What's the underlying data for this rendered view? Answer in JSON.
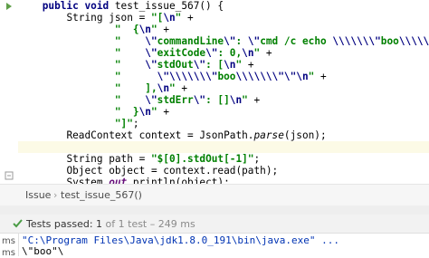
{
  "editor": {
    "lines": [
      {
        "indent": "    ",
        "tokens": [
          {
            "t": "public void ",
            "c": "kw"
          },
          {
            "t": "test_issue_567() {",
            "c": ""
          }
        ]
      },
      {
        "indent": "        ",
        "tokens": [
          {
            "t": "String json = ",
            "c": ""
          },
          {
            "t": "\"[",
            "c": "str"
          },
          {
            "t": "\\n",
            "c": "esc"
          },
          {
            "t": "\"",
            "c": "str"
          },
          {
            "t": " +",
            "c": ""
          }
        ]
      },
      {
        "indent": "                ",
        "tokens": [
          {
            "t": "\"  {",
            "c": "str"
          },
          {
            "t": "\\n",
            "c": "esc"
          },
          {
            "t": "\"",
            "c": "str"
          },
          {
            "t": " +",
            "c": ""
          }
        ]
      },
      {
        "indent": "                ",
        "tokens": [
          {
            "t": "\"    ",
            "c": "str"
          },
          {
            "t": "\\\"",
            "c": "esc"
          },
          {
            "t": "commandLine",
            "c": "str"
          },
          {
            "t": "\\\"",
            "c": "esc"
          },
          {
            "t": ": ",
            "c": "str"
          },
          {
            "t": "\\\"",
            "c": "esc"
          },
          {
            "t": "cmd /c echo ",
            "c": "str"
          },
          {
            "t": "\\\\\\\\\\\\\\\"",
            "c": "esc"
          },
          {
            "t": "boo",
            "c": "str"
          },
          {
            "t": "\\\\\\\\\\\\\\\"",
            "c": "esc"
          },
          {
            "t": "\\\"",
            "c": "esc"
          },
          {
            "t": ",",
            "c": "str"
          },
          {
            "t": "\\n",
            "c": "esc"
          },
          {
            "t": "\" +",
            "c": "str"
          }
        ]
      },
      {
        "indent": "                ",
        "tokens": [
          {
            "t": "\"    ",
            "c": "str"
          },
          {
            "t": "\\\"",
            "c": "esc"
          },
          {
            "t": "exitCode",
            "c": "str"
          },
          {
            "t": "\\\"",
            "c": "esc"
          },
          {
            "t": ": 0,",
            "c": "str"
          },
          {
            "t": "\\n",
            "c": "esc"
          },
          {
            "t": "\"",
            "c": "str"
          },
          {
            "t": " +",
            "c": ""
          }
        ]
      },
      {
        "indent": "                ",
        "tokens": [
          {
            "t": "\"    ",
            "c": "str"
          },
          {
            "t": "\\\"",
            "c": "esc"
          },
          {
            "t": "stdOut",
            "c": "str"
          },
          {
            "t": "\\\"",
            "c": "esc"
          },
          {
            "t": ": [",
            "c": "str"
          },
          {
            "t": "\\n",
            "c": "esc"
          },
          {
            "t": "\"",
            "c": "str"
          },
          {
            "t": " +",
            "c": ""
          }
        ]
      },
      {
        "indent": "                ",
        "tokens": [
          {
            "t": "\"      ",
            "c": "str"
          },
          {
            "t": "\\\"\\\\\\\\\\\\\\\"",
            "c": "esc"
          },
          {
            "t": "boo",
            "c": "str"
          },
          {
            "t": "\\\\\\\\\\\\\\\"\\\"",
            "c": "esc"
          },
          {
            "t": "\\n",
            "c": "esc"
          },
          {
            "t": "\"",
            "c": "str"
          },
          {
            "t": " +",
            "c": ""
          }
        ]
      },
      {
        "indent": "                ",
        "tokens": [
          {
            "t": "\"    ],",
            "c": "str"
          },
          {
            "t": "\\n",
            "c": "esc"
          },
          {
            "t": "\"",
            "c": "str"
          },
          {
            "t": " +",
            "c": ""
          }
        ]
      },
      {
        "indent": "                ",
        "tokens": [
          {
            "t": "\"    ",
            "c": "str"
          },
          {
            "t": "\\\"",
            "c": "esc"
          },
          {
            "t": "stdErr",
            "c": "str"
          },
          {
            "t": "\\\"",
            "c": "esc"
          },
          {
            "t": ": []",
            "c": "str"
          },
          {
            "t": "\\n",
            "c": "esc"
          },
          {
            "t": "\"",
            "c": "str"
          },
          {
            "t": " +",
            "c": ""
          }
        ]
      },
      {
        "indent": "                ",
        "tokens": [
          {
            "t": "\"  }",
            "c": "str"
          },
          {
            "t": "\\n",
            "c": "esc"
          },
          {
            "t": "\"",
            "c": "str"
          },
          {
            "t": " +",
            "c": ""
          }
        ]
      },
      {
        "indent": "                ",
        "tokens": [
          {
            "t": "\"]\"",
            "c": "str"
          },
          {
            "t": ";",
            "c": ""
          }
        ]
      },
      {
        "indent": "        ",
        "tokens": [
          {
            "t": "ReadContext context = JsonPath.",
            "c": ""
          },
          {
            "t": "parse",
            "c": "mth"
          },
          {
            "t": "(json);",
            "c": ""
          }
        ]
      },
      {
        "indent": "",
        "tokens": [],
        "highlight": true
      },
      {
        "indent": "        ",
        "tokens": [
          {
            "t": "String path = ",
            "c": ""
          },
          {
            "t": "\"$[0].stdOut[-1]\"",
            "c": "str"
          },
          {
            "t": ";",
            "c": ""
          }
        ]
      },
      {
        "indent": "        ",
        "tokens": [
          {
            "t": "Object object = context.read(path);",
            "c": ""
          }
        ]
      },
      {
        "indent": "        ",
        "tokens": [
          {
            "t": "System.",
            "c": ""
          },
          {
            "t": "out",
            "c": "fld"
          },
          {
            "t": ".println(object);",
            "c": ""
          }
        ]
      },
      {
        "indent": "    ",
        "tokens": [
          {
            "t": "}",
            "c": ""
          }
        ]
      },
      {
        "indent": "}",
        "tokens": []
      }
    ]
  },
  "breadcrumb": {
    "item1": "Issue",
    "separator": "›",
    "item2": "test_issue_567()"
  },
  "run_status": {
    "label": "Tests passed:",
    "count": "1",
    "detail": "of 1 test",
    "dash": "–",
    "duration": "249 ms",
    "icon": "check-icon",
    "icon_color": "#4a9c45"
  },
  "console": {
    "time1": "ms",
    "time2": "ms",
    "line1": "\"C:\\Program Files\\Java\\jdk1.8.0_191\\bin\\java.exe\" ...",
    "line2": "\\\"boo\"\\"
  }
}
